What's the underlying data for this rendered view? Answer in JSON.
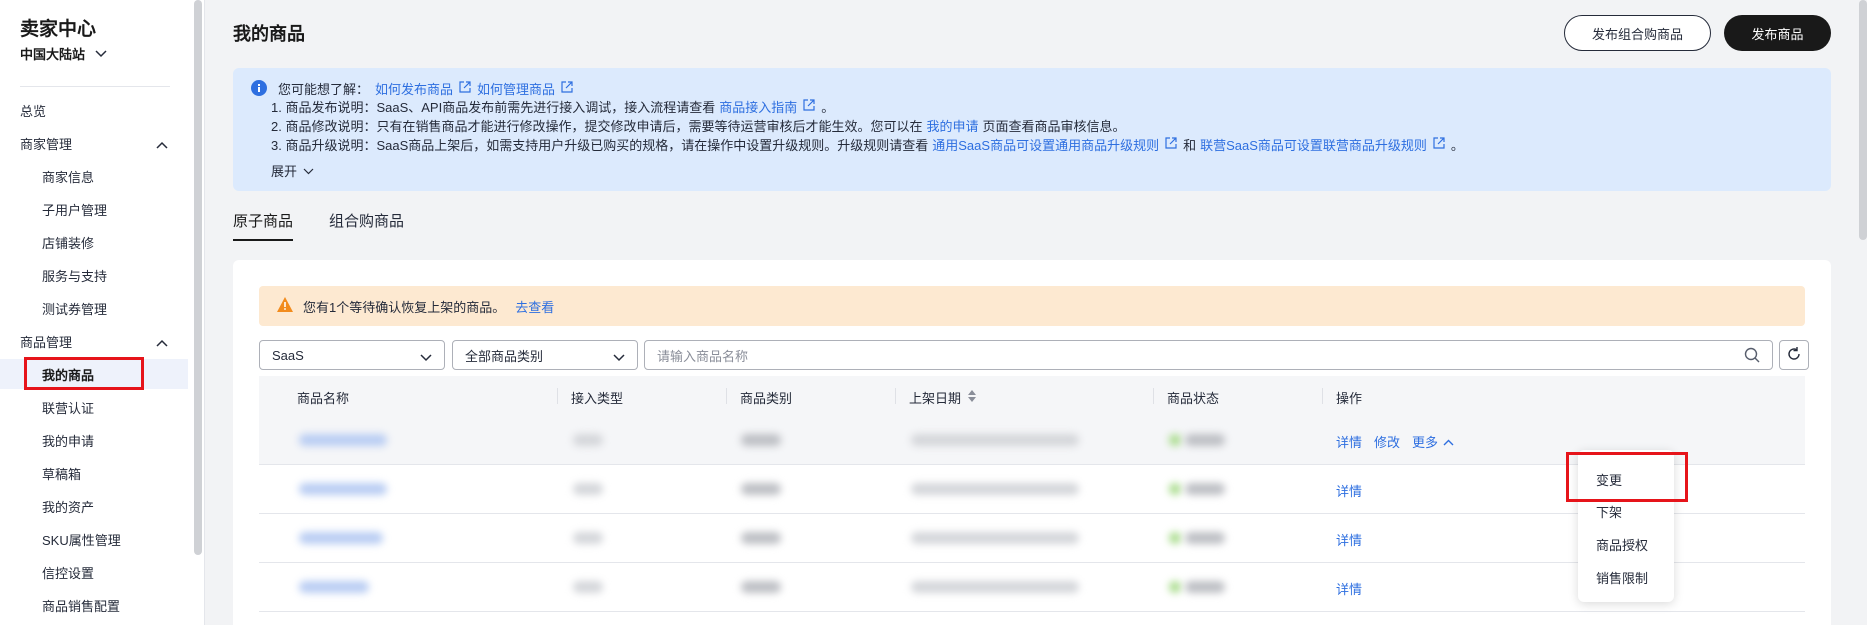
{
  "sidebar": {
    "title": "卖家中心",
    "site": "中国大陆站",
    "items": [
      {
        "label": "总览"
      },
      {
        "label": "商家管理"
      },
      {
        "label": "商家信息"
      },
      {
        "label": "子用户管理"
      },
      {
        "label": "店铺装修"
      },
      {
        "label": "服务与支持"
      },
      {
        "label": "测试券管理"
      },
      {
        "label": "商品管理"
      },
      {
        "label": "我的商品"
      },
      {
        "label": "联营认证"
      },
      {
        "label": "我的申请"
      },
      {
        "label": "草稿箱"
      },
      {
        "label": "我的资产"
      },
      {
        "label": "SKU属性管理"
      },
      {
        "label": "信控设置"
      },
      {
        "label": "商品销售配置"
      }
    ]
  },
  "header": {
    "title": "我的商品",
    "btn_combo": "发布组合购商品",
    "btn_publish": "发布商品"
  },
  "notice": {
    "lead": "您可能想了解：",
    "link1": "如何发布商品",
    "link2": "如何管理商品",
    "l1_text": "1. 商品发布说明：SaaS、API商品发布前需先进行接入调试，接入流程请查看",
    "l1_link": "商品接入指南",
    "l1_end": "。",
    "l2_text": "2. 商品修改说明：只有在销售商品才能进行修改操作，提交修改申请后，需要等待运营审核后才能生效。您可以在",
    "l2_link": "我的申请",
    "l2_end": "页面查看商品审核信息。",
    "l3_text": "3. 商品升级说明：SaaS商品上架后，如需支持用户升级已购买的规格，请在操作中设置升级规则。升级规则请查看",
    "l3_link1": "通用SaaS商品可设置通用商品升级规则",
    "l3_and": "和",
    "l3_link2": "联营SaaS商品可设置联营商品升级规则",
    "l3_end": "。",
    "expand": "展开"
  },
  "tabs": [
    {
      "label": "原子商品"
    },
    {
      "label": "组合购商品"
    }
  ],
  "warning": {
    "text": "您有1个等待确认恢复上架的商品。",
    "link": "去查看"
  },
  "filters": {
    "type_value": "SaaS",
    "category_value": "全部商品类别",
    "search_placeholder": "请输入商品名称"
  },
  "table": {
    "columns": [
      "商品名称",
      "接入类型",
      "商品类别",
      "上架日期",
      "商品状态",
      "操作"
    ],
    "row_actions": {
      "detail": "详情",
      "edit": "修改",
      "more": "更多"
    }
  },
  "dropdown": {
    "items": [
      "变更",
      "下架",
      "商品授权",
      "销售限制"
    ]
  },
  "colors": {
    "link": "#2e6fe0",
    "highlight": "#e6141a",
    "notice_bg": "#dceafd",
    "warning_bg": "#fde9d1"
  }
}
